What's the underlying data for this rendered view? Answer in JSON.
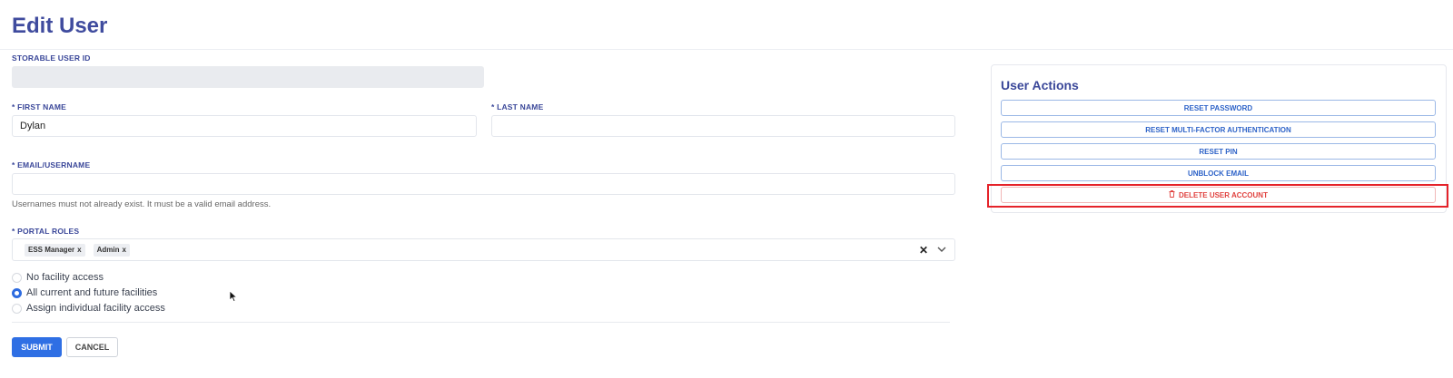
{
  "page": {
    "title": "Edit User"
  },
  "form": {
    "storable_user_id": {
      "label": "STORABLE USER ID",
      "value": ""
    },
    "first_name": {
      "label": "* FIRST NAME",
      "value": "Dylan"
    },
    "last_name": {
      "label": "* LAST NAME",
      "value": ""
    },
    "email": {
      "label": "* EMAIL/USERNAME",
      "value": "",
      "hint": "Usernames must not already exist. It must be a valid email address."
    },
    "portal_roles": {
      "label": "* PORTAL ROLES",
      "chips": [
        "ESS Manager",
        "Admin"
      ],
      "chip_remove_glyph": "x",
      "clear_glyph": "✕",
      "icon": "chevron-down-icon"
    },
    "facility_access": {
      "options": [
        {
          "label": "No facility access",
          "checked": false
        },
        {
          "label": "All current and future facilities",
          "checked": true
        },
        {
          "label": "Assign individual facility access",
          "checked": false
        }
      ]
    },
    "submit_label": "SUBMIT",
    "cancel_label": "CANCEL"
  },
  "user_actions": {
    "title": "User Actions",
    "buttons": [
      {
        "label": "RESET PASSWORD"
      },
      {
        "label": "RESET MULTI-FACTOR AUTHENTICATION"
      },
      {
        "label": "RESET PIN"
      },
      {
        "label": "UNBLOCK EMAIL"
      }
    ],
    "delete": {
      "label": "DELETE USER ACCOUNT",
      "icon": "trash-icon",
      "color": "#e0423f"
    }
  },
  "colors": {
    "heading": "#3a4799",
    "primary": "#2f6fe4",
    "danger": "#e0423f",
    "highlight": "#e5232a"
  }
}
